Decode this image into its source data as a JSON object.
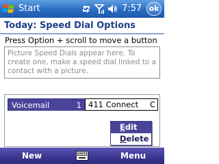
{
  "title_bar": {
    "app_title": "Start",
    "clock": "7:57",
    "ok_label": "ok",
    "icons": [
      "windows-flag-icon",
      "sync-icon",
      "signal-antenna-icon",
      "speaker-icon"
    ]
  },
  "header": {
    "title": "Today: Speed Dial Options"
  },
  "instruction": "Press Option + scroll to move a button",
  "picture_box": {
    "text": "Picture Speed Dials appear here. To create one, make a speed dial linked to a contact with a picture."
  },
  "speed_dials": [
    {
      "name": "Voicemail",
      "key": "1",
      "selected": true
    },
    {
      "name": "411 Connect",
      "key": "C",
      "selected": false
    }
  ],
  "context_menu": {
    "items": [
      {
        "label_underlined": "E",
        "label_rest": "dit",
        "selected": true
      },
      {
        "label_underlined": "D",
        "label_rest": "elete",
        "selected": false
      }
    ]
  },
  "softkeys": {
    "left": "New",
    "right": "Menu",
    "center_icon": "keyboard-icon"
  },
  "colors": {
    "title_bar": "#2a6cc4",
    "heading_text": "#1f3f8a",
    "selection": "#4a4499",
    "softkey_bar": "#3b3690"
  }
}
